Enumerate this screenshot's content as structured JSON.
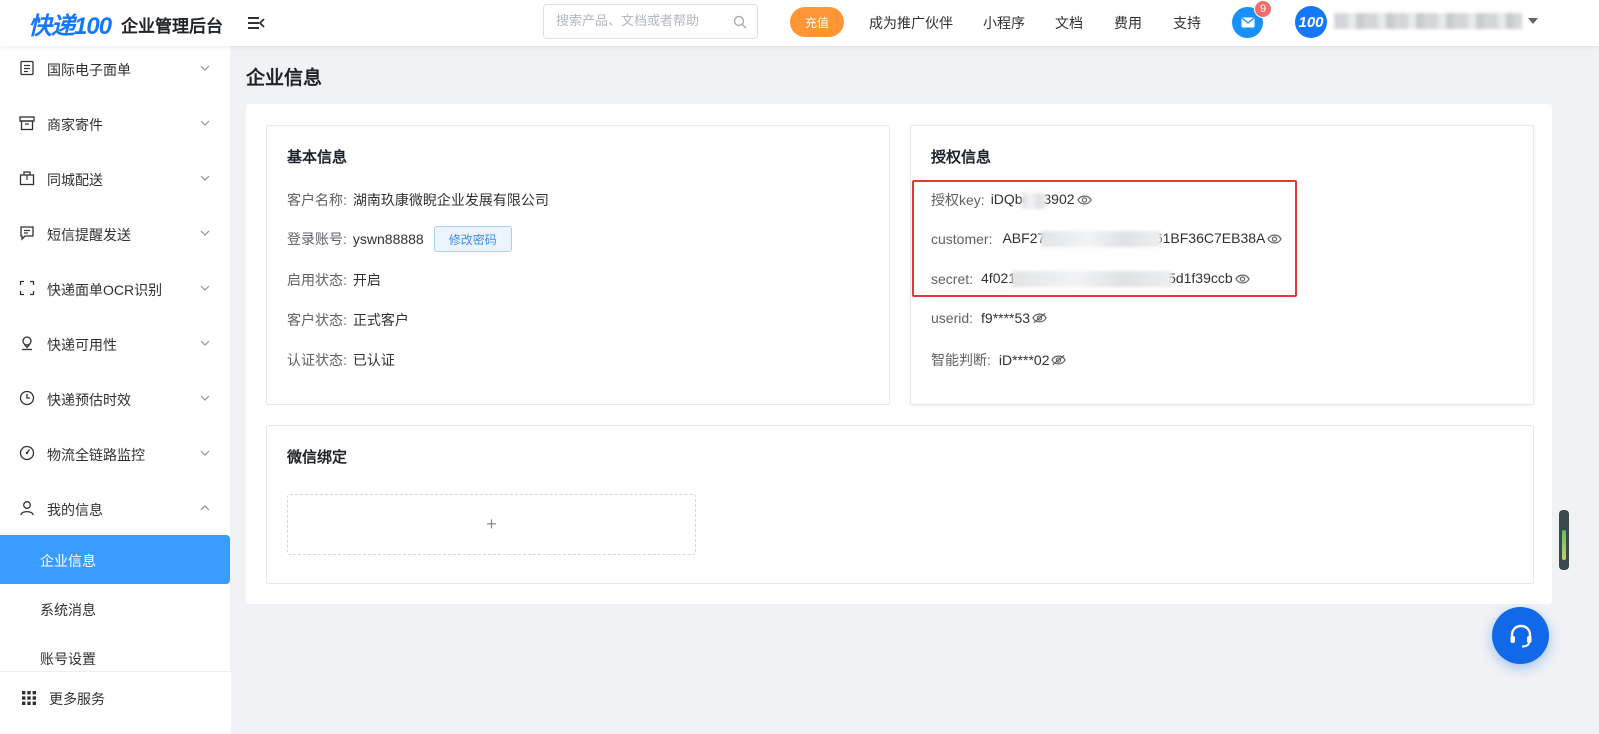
{
  "header": {
    "logo_text": "快递100",
    "app_title": "企业管理后台",
    "search_placeholder": "搜索产品、文档或者帮助",
    "recharge_label": "充值",
    "nav_links": [
      "成为推广伙伴",
      "小程序",
      "文档",
      "费用",
      "支持"
    ],
    "mail_badge": "9",
    "avatar_text": "100",
    "colors": {
      "brand": "#1478ff",
      "recharge": "#ff9535",
      "badge": "#f56c6c"
    }
  },
  "sidebar": {
    "items": [
      {
        "label": "国际电子面单",
        "icon": "document-list-icon"
      },
      {
        "label": "商家寄件",
        "icon": "archive-box-icon"
      },
      {
        "label": "同城配送",
        "icon": "package-icon"
      },
      {
        "label": "短信提醒发送",
        "icon": "message-icon"
      },
      {
        "label": "快递面单OCR识别",
        "icon": "scan-frame-icon"
      },
      {
        "label": "快递可用性",
        "icon": "location-pin-icon"
      },
      {
        "label": "快递预估时效",
        "icon": "clock-icon"
      },
      {
        "label": "物流全链路监控",
        "icon": "gauge-icon"
      },
      {
        "label": "我的信息",
        "icon": "user-icon"
      }
    ],
    "sub_items": [
      {
        "label": "企业信息",
        "active": true
      },
      {
        "label": "系统消息",
        "active": false
      },
      {
        "label": "账号设置",
        "active": false
      }
    ],
    "more_services_label": "更多服务",
    "active_color": "#3b9cff"
  },
  "main": {
    "page_title": "企业信息",
    "basic_info": {
      "title": "基本信息",
      "customer_name_label": "客户名称:",
      "customer_name": "湖南玖康微睨企业发展有限公司",
      "login_account_label": "登录账号:",
      "login_account": "yswn88888",
      "change_password_label": "修改密码",
      "enable_status_label": "启用状态:",
      "enable_status": "开启",
      "customer_status_label": "客户状态:",
      "customer_status": "正式客户",
      "auth_status_label": "认证状态:",
      "auth_status": "已认证"
    },
    "auth_info": {
      "title": "授权信息",
      "key_label": "授权key:",
      "key_start": "iDQbc",
      "key_end": "q3902",
      "customer_label": "customer:",
      "customer_start": "ABF273",
      "customer_end": "161BF36C7EB38A",
      "secret_label": "secret:",
      "secret_start": "4f021",
      "secret_end": "5d1f39ccb",
      "userid_label": "userid:",
      "userid": "f9****53",
      "smart_label": "智能判断:",
      "smart": "iD****02",
      "highlight_color": "#e53935"
    },
    "wechat": {
      "title": "微信绑定",
      "add_symbol": "+"
    }
  }
}
